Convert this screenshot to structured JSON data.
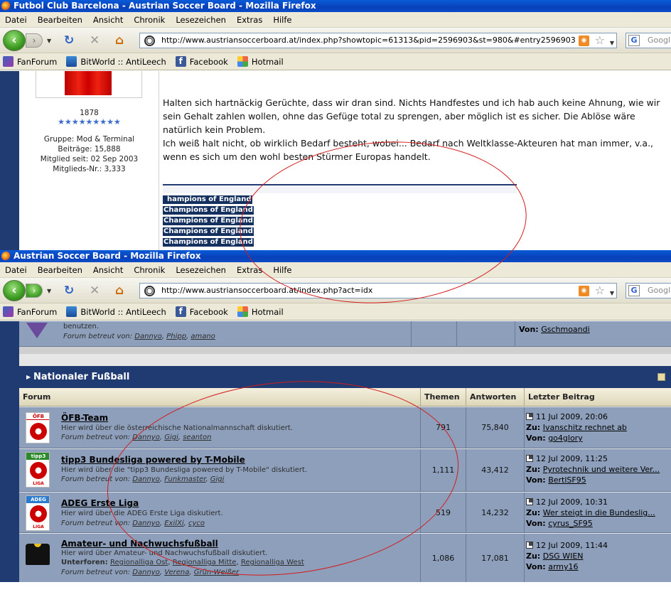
{
  "window1": {
    "title": "Futbol Club Barcelona - Austrian Soccer Board - Mozilla Firefox",
    "menu": [
      "Datei",
      "Bearbeiten",
      "Ansicht",
      "Chronik",
      "Lesezeichen",
      "Extras",
      "Hilfe"
    ],
    "url": "http://www.austriansoccerboard.at/index.php?showtopic=61313&pid=2596903&st=980&#entry2596903",
    "bookmarks": [
      "FanForum",
      "BitWorld :: AntiLeech",
      "Facebook",
      "Hotmail"
    ],
    "search_placeholder": "Googl",
    "user": {
      "points": "1878",
      "stars": "★★★★★★★★★",
      "group": "Gruppe: Mod & Terminal",
      "posts": "Beiträge: 15,888",
      "member_since": "Mitglied seit: 02 Sep 2003",
      "member_no": "Mitglieds-Nr.: 3,333"
    },
    "post_text": "Halten sich hartnäckig Gerüchte, dass wir dran sind. Nichts Handfestes und ich hab auch keine Ahnung, wie wir sein Gehalt zahlen wollen, ohne das Gefüge total zu sprengen, aber möglich ist es sicher. Die Ablöse wäre natürlich kein Problem.",
    "post_text2": "Ich weiß halt nicht, ob wirklich Bedarf besteht, wobei... Bedarf nach Weltklasse-Akteuren hat man immer, v.a., wenn es sich um den wohl besten Stürmer Europas handelt.",
    "signature": [
      "hampions of England",
      "Champions of England",
      "Champions of England",
      "Champions of England",
      "Champions of England"
    ]
  },
  "window2": {
    "title": "Austrian Soccer Board - Mozilla Firefox",
    "menu": [
      "Datei",
      "Bearbeiten",
      "Ansicht",
      "Chronik",
      "Lesezeichen",
      "Extras",
      "Hilfe"
    ],
    "url": "http://www.austriansoccerboard.at/index.php?act=idx",
    "bookmarks": [
      "FanForum",
      "BitWorld :: AntiLeech",
      "Facebook",
      "Hotmail"
    ],
    "search_placeholder": "Googl",
    "prev_row": {
      "desc": "benutzen.",
      "mod_label": "Forum betreut von:",
      "mods": [
        "Dannyo",
        "Phipp",
        "amano"
      ],
      "last_by_label": "Von:",
      "last_by": "Gschmoandi"
    },
    "category": "Nationaler Fußball",
    "columns": {
      "forum": "Forum",
      "topics": "Themen",
      "replies": "Antworten",
      "last": "Letzter Beitrag"
    },
    "forums": [
      {
        "name": "ÖFB-Team",
        "desc": "Hier wird über die österreichische Nationalmannschaft diskutiert.",
        "mod_label": "Forum betreut von:",
        "mods": [
          "Dannyo",
          "Gigi",
          "seanton"
        ],
        "topics": "791",
        "replies": "75,840",
        "date": "11 Jul 2009, 20:06",
        "to_label": "Zu:",
        "to": "Ivanschitz rechnet ab",
        "by_label": "Von:",
        "by": "go4glory",
        "badge": "ÖFB"
      },
      {
        "name": "tipp3 Bundesliga powered by T-Mobile",
        "desc": "Hier wird über die \"tipp3 Bundesliga powered by T-Mobile\" diskutiert.",
        "mod_label": "Forum betreut von:",
        "mods": [
          "Dannyo",
          "Funkmaster",
          "Gigi"
        ],
        "topics": "1,111",
        "replies": "43,412",
        "date": "12 Jul 2009, 11:25",
        "to_label": "Zu:",
        "to": "Pyrotechnik und weitere Ver...",
        "by_label": "Von:",
        "by": "BertlSF95",
        "badge": "tipp3",
        "logo_text": "LIGA"
      },
      {
        "name": "ADEG Erste Liga",
        "desc": "Hier wird über die ADEG Erste Liga diskutiert.",
        "mod_label": "Forum betreut von:",
        "mods": [
          "Dannyo",
          "ExilXi",
          "cyco"
        ],
        "topics": "519",
        "replies": "14,232",
        "date": "12 Jul 2009, 10:31",
        "to_label": "Zu:",
        "to": "Wer steigt in die Bundeslig...",
        "by_label": "Von:",
        "by": "cyrus_SF95",
        "badge": "ADEG",
        "logo_text": "LIGA"
      },
      {
        "name": "Amateur- und Nachwuchsfußball",
        "desc": "Hier wird über Amateur- und Nachwuchsfußball diskutiert.",
        "sub_label": "Unterforen:",
        "subs": [
          "Regionalliga Ost",
          "Regionalliga Mitte",
          "Regionalliga West"
        ],
        "mod_label": "Forum betreut von:",
        "mods": [
          "Dannyo",
          "Verena",
          "Grün-Weißer"
        ],
        "topics": "1,086",
        "replies": "17,081",
        "date": "12 Jul 2009, 11:44",
        "to_label": "Zu:",
        "to": "DSG WIEN",
        "by_label": "Von:",
        "by": "army16"
      }
    ]
  },
  "colors": {
    "titlebar": "#0840b8",
    "forum_blue": "#1f3b72",
    "row": "#8d9fba",
    "annotation": "#d41a1a"
  }
}
